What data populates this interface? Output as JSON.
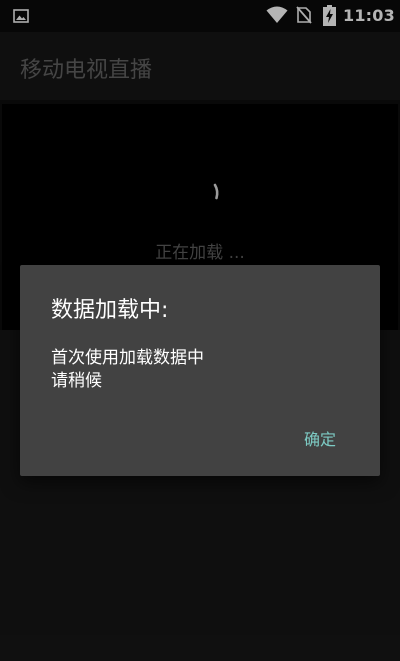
{
  "status_bar": {
    "time": "11:03",
    "icons": [
      "gallery-icon",
      "wifi-icon",
      "no-sim-icon",
      "battery-charging-icon"
    ]
  },
  "app_bar": {
    "title": "移动电视直播"
  },
  "player": {
    "loading_text": "正在加载 ..."
  },
  "dialog": {
    "title": "数据加载中:",
    "message_lines": [
      "首次使用加载数据中",
      "请稍候"
    ],
    "ok_label": "确定"
  },
  "colors": {
    "dialog_background": "#424242",
    "accent": "#7dcbc4",
    "app_background": "#141414"
  }
}
